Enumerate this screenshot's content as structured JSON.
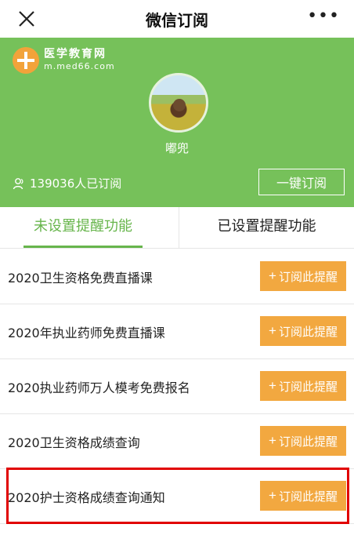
{
  "header": {
    "title": "微信订阅",
    "more": "•••"
  },
  "brand": {
    "name_cn": "医学教育网",
    "url": "m.med66.com"
  },
  "profile": {
    "username": "嘟兜",
    "subscribers": "139036人已订阅",
    "subscribe_all_label": "一键订阅"
  },
  "tabs": [
    {
      "label": "未设置提醒功能",
      "active": true
    },
    {
      "label": "已设置提醒功能",
      "active": false
    }
  ],
  "items": [
    {
      "title": "2020卫生资格免费直播课",
      "button": "订阅此提醒"
    },
    {
      "title": "2020年执业药师免费直播课",
      "button": "订阅此提醒"
    },
    {
      "title": "2020执业药师万人模考免费报名",
      "button": "订阅此提醒"
    },
    {
      "title": "2020卫生资格成绩查询",
      "button": "订阅此提醒"
    },
    {
      "title": "2020护士资格成绩查询通知",
      "button": "订阅此提醒"
    }
  ],
  "colors": {
    "hero": "#76c15a",
    "accent_green": "#67b54c",
    "button_orange": "#f2a840",
    "highlight_red": "#e10000"
  },
  "icons": [
    "close-icon",
    "more-icon",
    "logo-cross-icon",
    "user-icon",
    "plus-icon"
  ]
}
